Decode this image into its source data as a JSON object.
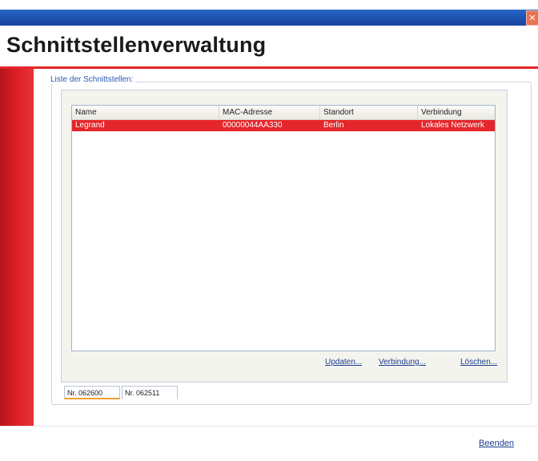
{
  "window": {
    "close_glyph": "✕"
  },
  "header": {
    "title": "Schnittstellenverwaltung"
  },
  "group": {
    "legend": "Liste der Schnittstellen:"
  },
  "table": {
    "columns": [
      "Name",
      "MAC-Adresse",
      "Standort",
      "Verbindung"
    ],
    "rows": [
      [
        "Legrand",
        "00000044AA330",
        "Berlin",
        "Lokales Netzwerk"
      ]
    ],
    "selected_row_color": "#e5262a"
  },
  "actions": {
    "update": "Updaten...",
    "connection": "Verbindung...",
    "delete": "Löschen..."
  },
  "tabs": [
    {
      "label": "Nr. 062600",
      "active": true
    },
    {
      "label": "Nr. 062511",
      "active": false
    }
  ],
  "footer": {
    "exit": "Beenden"
  },
  "colors": {
    "accent_red": "#e5262a",
    "titlebar_blue": "#1d4fad",
    "link_blue": "#1b3f8f"
  }
}
